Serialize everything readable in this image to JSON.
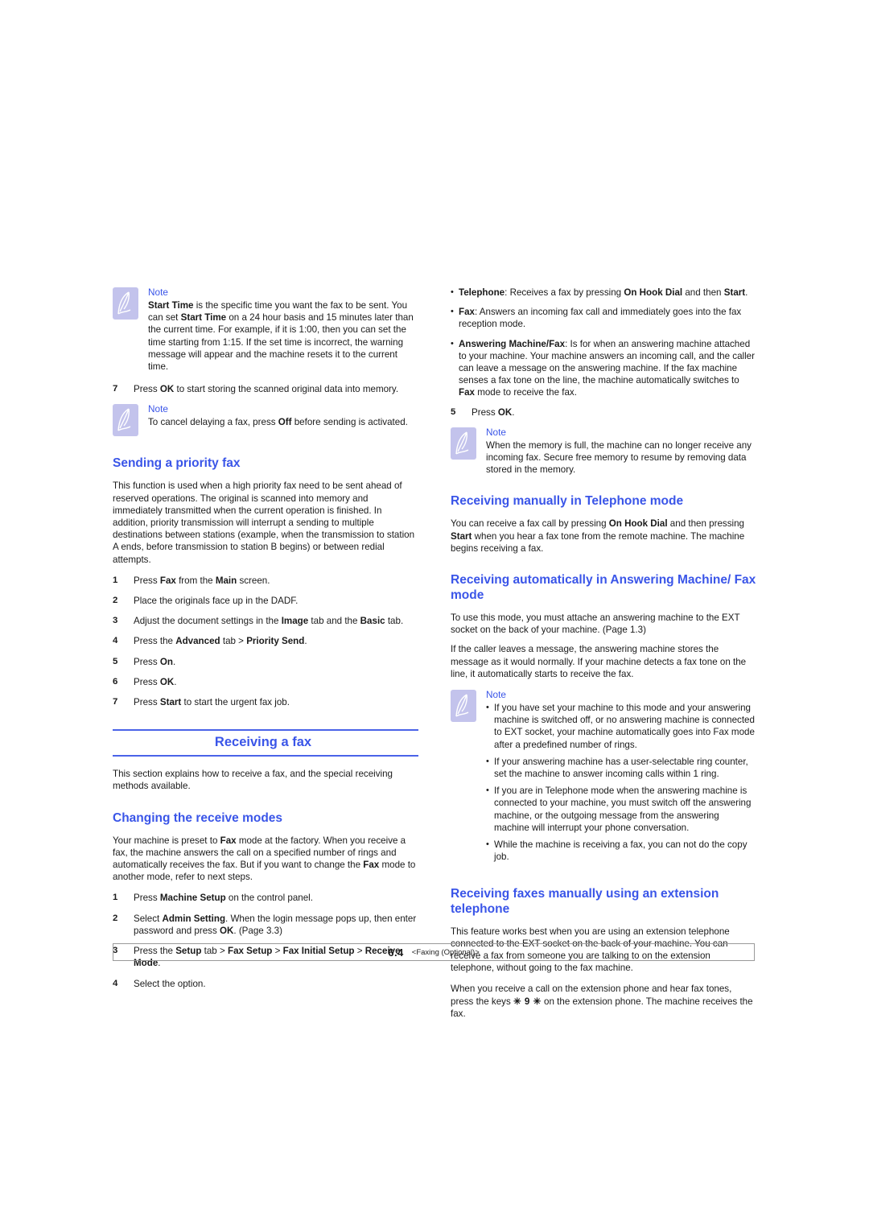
{
  "page": {
    "footer_number": "6.4",
    "footer_label": "<Faxing (Optional)>",
    "heading_color": "#3a55e8",
    "rule_color": "#4a63e8",
    "note_icon_color": "#c3c3ec"
  },
  "left_column": {
    "note_start_time": {
      "title": "Note",
      "text_parts": {
        "p1": "",
        "b1": "Start Time",
        "p2": " is the specific time you want the fax to be sent. You can set ",
        "b2": "Start Time",
        "p3": " on a 24 hour basis and 15 minutes later than the current time. For example, if it is 1:00, then you can set the time starting from 1:15. If the set time is incorrect, the warning message will appear and the machine resets it to the current time."
      }
    },
    "step7_delay": {
      "num": "7",
      "p1": "Press ",
      "b1": "OK",
      "p2": " to start storing the scanned original data into memory."
    },
    "note_cancel": {
      "title": "Note",
      "p1": "To cancel delaying a fax, press ",
      "b1": "Off",
      "p2": " before sending is activated."
    },
    "priority_fax": {
      "heading": "Sending a priority fax",
      "intro": "This function is used when a high priority fax need to be sent ahead of reserved operations. The original is scanned into memory and immediately transmitted when the current operation is finished. In addition, priority transmission will interrupt a sending to multiple destinations between stations (example, when the transmission to station A ends, before transmission to station B begins) or between redial attempts.",
      "steps": [
        {
          "num": "1",
          "p1": "Press ",
          "b1": "Fax",
          "p2": " from the ",
          "b2": "Main",
          "p3": " screen."
        },
        {
          "num": "2",
          "p1": "Place the originals face up in the DADF.",
          "b1": "",
          "p2": "",
          "b2": "",
          "p3": ""
        },
        {
          "num": "3",
          "p1": "Adjust the document settings in the ",
          "b1": "Image",
          "p2": " tab and the ",
          "b2": "Basic",
          "p3": " tab."
        },
        {
          "num": "4",
          "p1": "Press the ",
          "b1": "Advanced",
          "p2": " tab > ",
          "b2": "Priority Send",
          "p3": "."
        },
        {
          "num": "5",
          "p1": "Press ",
          "b1": "On",
          "p2": ".",
          "b2": "",
          "p3": ""
        },
        {
          "num": "6",
          "p1": "Press ",
          "b1": "OK",
          "p2": ".",
          "b2": "",
          "p3": ""
        },
        {
          "num": "7",
          "p1": "Press ",
          "b1": "Start",
          "p2": " to start the urgent fax job.",
          "b2": "",
          "p3": ""
        }
      ]
    },
    "receiving_fax": {
      "section_heading": "Receiving a fax",
      "intro": "This section explains how to receive a fax, and the special receiving methods available.",
      "sub_heading": "Changing the receive modes",
      "sub_intro": {
        "p1": "Your machine is preset to ",
        "b1": "Fax",
        "p2": " mode at the factory. When you receive a fax, the machine answers the call on a specified number of rings and automatically receives the fax. But if you want to change the ",
        "b2": "Fax",
        "p3": " mode to another mode, refer to next steps."
      },
      "steps": [
        {
          "num": "1",
          "p1": "Press ",
          "b1": "Machine Setup",
          "p2": " on the control panel.",
          "b2": "",
          "p3": "",
          "b3": "",
          "p4": ""
        },
        {
          "num": "2",
          "p1": "Select ",
          "b1": "Admin Setting",
          "p2": ". When the login message pops up, then enter password and press ",
          "b2": "OK",
          "p3": ". (Page 3.3)",
          "b3": "",
          "p4": ""
        },
        {
          "num": "3",
          "p1": "Press the ",
          "b1": "Setup",
          "p2": " tab > ",
          "b2": "Fax Setup",
          "p3": " > ",
          "b3": "Fax Initial Setup",
          "p4": " > ",
          "b4": "Receive Mode",
          "p5": "."
        },
        {
          "num": "4",
          "p1": "Select the option.",
          "b1": "",
          "p2": "",
          "b2": "",
          "p3": "",
          "b3": "",
          "p4": ""
        }
      ]
    }
  },
  "right_column": {
    "mode_bullets": [
      {
        "b1": "Telephone",
        "p1": ": Receives a fax by pressing ",
        "b2": "On Hook Dial",
        "p2": " and then ",
        "b3": "Start",
        "p3": "."
      },
      {
        "b1": "Fax",
        "p1": ": Answers an incoming fax call and immediately goes into the fax reception mode.",
        "b2": "",
        "p2": "",
        "b3": "",
        "p3": ""
      },
      {
        "b1": "Answering Machine/Fax",
        "p1": ": Is for when an answering machine attached to your machine. Your machine answers an incoming call, and the caller can leave a message on the answering machine. If the fax machine senses a fax tone on the line, the machine automatically switches to ",
        "b2": "Fax",
        "p2": " mode to receive the fax.",
        "b3": "",
        "p3": ""
      }
    ],
    "step5": {
      "num": "5",
      "p1": "Press ",
      "b1": "OK",
      "p2": "."
    },
    "note_memory": {
      "title": "Note",
      "text": "When the memory is full, the machine can no longer receive any incoming fax. Secure free memory to resume by removing data stored in the memory."
    },
    "telephone_mode": {
      "heading": "Receiving manually in Telephone mode",
      "p1": "You can receive a fax call by pressing ",
      "b1": "On Hook Dial",
      "p2": " and then pressing ",
      "b2": "Start",
      "p3": " when you hear a fax tone from the remote machine. The machine begins receiving a fax."
    },
    "answering_machine_mode": {
      "heading": "Receiving automatically in Answering Machine/ Fax mode",
      "para1": "To use this mode, you must attache an answering machine to the EXT socket on the back of your machine. (Page 1.3)",
      "para2": "If the caller leaves a message, the answering machine stores the message as it would normally. If your machine detects a fax tone on the line, it automatically starts to receive the fax."
    },
    "note_answering": {
      "title": "Note",
      "bullets": [
        "If you have set your machine to this mode and your answering machine is switched off, or no answering machine is connected to EXT socket, your machine automatically goes into Fax mode after a predefined number of rings.",
        "If your answering machine has a user-selectable ring counter, set the machine to answer incoming calls within 1 ring.",
        "If you are in Telephone mode when the answering machine is connected to your machine, you must switch off the answering machine, or the outgoing message from the answering machine will interrupt your phone conversation.",
        "While the machine is receiving a fax, you can not do the copy job."
      ]
    },
    "extension_telephone": {
      "heading": "Receiving faxes manually using an extension telephone",
      "para1": "This feature works best when you are using an extension telephone connected to the EXT socket on the back of your machine. You can receive a fax from someone you are talking to on the extension telephone, without going to the fax machine.",
      "para2_p1": "When you receive a call on the extension phone and hear fax tones, press the keys ",
      "para2_keys": "✳ 9 ✳",
      "para2_p2": " on the extension phone. The machine receives the fax."
    }
  }
}
